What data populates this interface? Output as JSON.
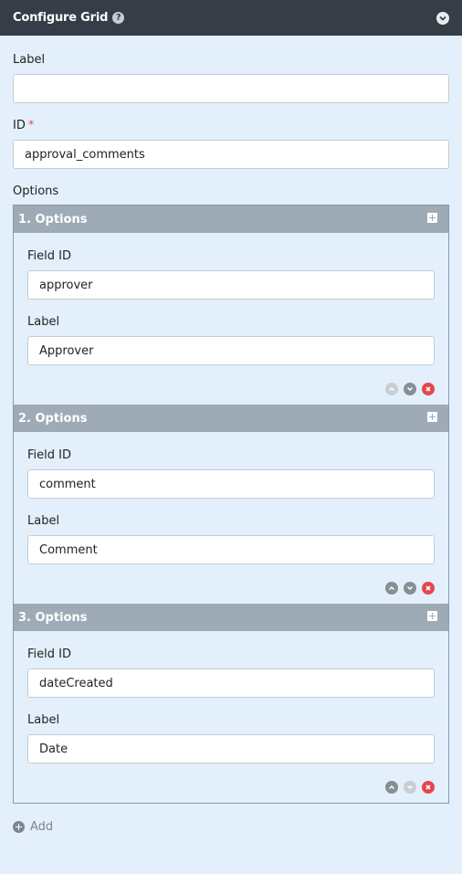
{
  "header": {
    "title": "Configure Grid",
    "help_icon": "question-circle-icon",
    "collapse_icon": "chevron-down-circle-icon"
  },
  "fields": {
    "label": {
      "label": "Label",
      "value": ""
    },
    "id": {
      "label": "ID",
      "required_marker": "*",
      "value": "approval_comments"
    },
    "options_label": "Options"
  },
  "options": [
    {
      "title": "1. Options",
      "field_id_label": "Field ID",
      "field_id": "approver",
      "label_label": "Label",
      "label": "Approver",
      "up_enabled": false,
      "down_enabled": true
    },
    {
      "title": "2. Options",
      "field_id_label": "Field ID",
      "field_id": "comment",
      "label_label": "Label",
      "label": "Comment",
      "up_enabled": true,
      "down_enabled": true
    },
    {
      "title": "3. Options",
      "field_id_label": "Field ID",
      "field_id": "dateCreated",
      "label_label": "Label",
      "label": "Date",
      "up_enabled": true,
      "down_enabled": false
    }
  ],
  "add_label": "Add",
  "colors": {
    "header_bg": "#363d46",
    "panel_bg": "#e3f0fc",
    "option_header_bg": "#9eabb7",
    "delete": "#e4484c"
  }
}
